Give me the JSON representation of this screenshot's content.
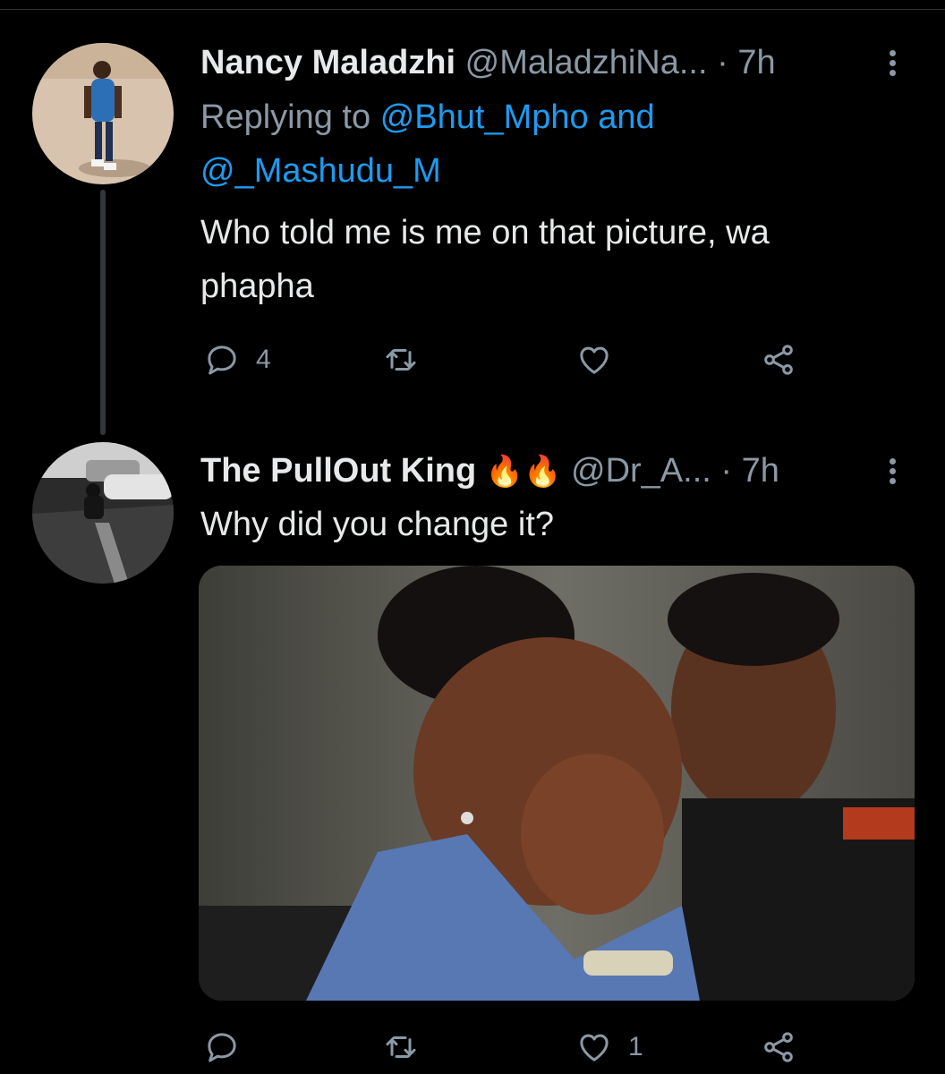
{
  "tweets": [
    {
      "display_name": "Nancy Maladzhi",
      "handle": "@MaladzhiNa...",
      "time": "7h",
      "replying_prefix": "Replying to",
      "replying_to": [
        "@Bhut_Mpho",
        "@_Mashudu_M"
      ],
      "replying_joiner": "and",
      "text_lines": [
        "Who told me is me on that picture, wa",
        "phapha"
      ],
      "actions": {
        "reply_count": "4",
        "retweet_count": "",
        "like_count": ""
      }
    },
    {
      "display_name": "The PullOut King",
      "name_emoji": "🔥🔥",
      "handle": "@Dr_A...",
      "time": "7h",
      "text_lines": [
        "Why did you change it?"
      ],
      "actions": {
        "reply_count": "",
        "retweet_count": "",
        "like_count": "1"
      }
    }
  ],
  "separator": "·",
  "colors": {
    "background": "#000000",
    "text": "#e7e9ea",
    "muted": "#8b98a5",
    "link": "#1d9bf0"
  },
  "icons": [
    "reply-icon",
    "retweet-icon",
    "like-icon",
    "share-icon",
    "more-icon",
    "fire-icon"
  ]
}
